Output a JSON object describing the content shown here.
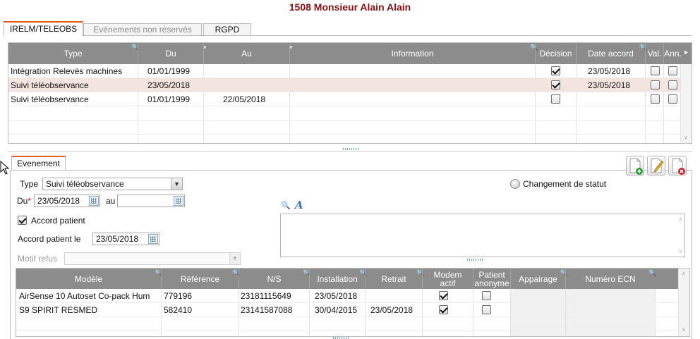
{
  "header": {
    "title": "1508 Monsieur Alain Alain"
  },
  "tabs": [
    {
      "label": "IRELM/TELEOBS",
      "active": true
    },
    {
      "label": "Evénements non réservés",
      "active": false
    },
    {
      "label": "RGPD",
      "active": false
    }
  ],
  "events_grid": {
    "columns": [
      "Type",
      "Du",
      "Au",
      "Information",
      "Décision",
      "Date accord",
      "Val.",
      "Ann."
    ],
    "rows": [
      {
        "type": "Intégration Relevés machines",
        "du": "01/01/1999",
        "au": "",
        "information": "",
        "decision": true,
        "date_accord": "23/05/2018",
        "val": false,
        "ann": false
      },
      {
        "type": "Suivi téléobservance",
        "du": "23/05/2018",
        "au": "",
        "information": "",
        "decision": true,
        "date_accord": "23/05/2018",
        "val": false,
        "ann": false
      },
      {
        "type": "Suivi téléobservance",
        "du": "01/01/1999",
        "au": "22/05/2018",
        "information": "",
        "decision": false,
        "date_accord": "",
        "val": false,
        "ann": false
      }
    ],
    "selected_row": 1
  },
  "detail_tab": {
    "label": "Evenement"
  },
  "form": {
    "type_label": "Type",
    "type_value": "Suivi téléobservance",
    "du_label": "Du",
    "required_mark": "*",
    "du_value": "23/05/2018",
    "au_label": "au",
    "au_value": "",
    "accord_patient_label": "Accord patient",
    "accord_patient_checked": true,
    "accord_patient_le_label": "Accord patient le",
    "accord_patient_le_value": "23/05/2018",
    "motif_refus_label": "Motif refus",
    "motif_refus_value": "",
    "changement_statut_label": "Changement de statut",
    "information_text": ""
  },
  "actions": [
    {
      "name": "add",
      "icon": "add-document-icon"
    },
    {
      "name": "edit",
      "icon": "edit-document-icon"
    },
    {
      "name": "delete",
      "icon": "delete-document-icon"
    }
  ],
  "devices_grid": {
    "columns": [
      "Modèle",
      "Référence",
      "N/S",
      "Installation",
      "Retrait",
      "Modem actif",
      "Patient anonyme",
      "Appairage",
      "Numéro ECN"
    ],
    "rows": [
      {
        "modele": "AirSense 10 Autoset Co-pack Hum",
        "reference": "779196",
        "ns": "23181115649",
        "installation": "23/05/2018",
        "retrait": "",
        "modem_actif": true,
        "patient_anonyme": false,
        "appairage": "",
        "numero_ecn": ""
      },
      {
        "modele": "S9 SPIRIT RESMED",
        "reference": "582410",
        "ns": "23141587088",
        "installation": "30/04/2015",
        "retrait": "23/05/2018",
        "modem_actif": true,
        "patient_anonyme": false,
        "appairage": "",
        "numero_ecn": ""
      }
    ]
  },
  "colors": {
    "title": "#8b1010",
    "active_tab_accent": "#e25b1f",
    "header_bg": "#8c8c8c",
    "selected_row": "#f4e4e0",
    "required": "#cc0000"
  }
}
